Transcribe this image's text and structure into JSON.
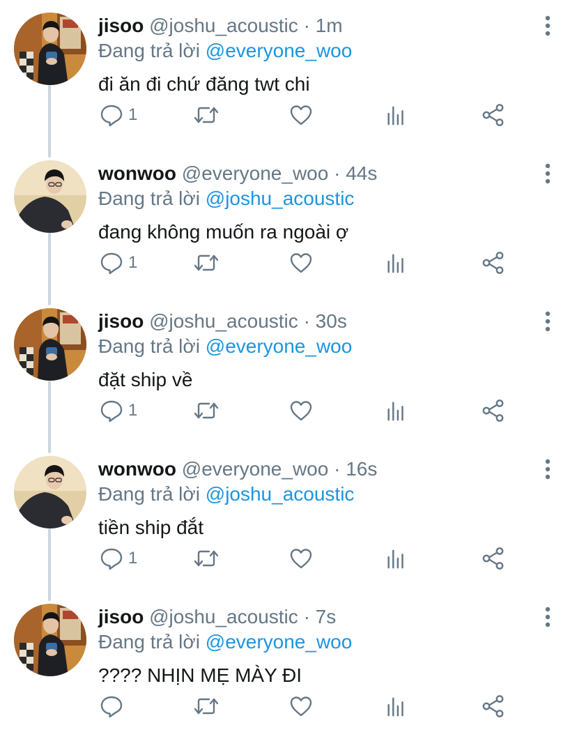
{
  "replying_prefix": "Đang trả lời",
  "colors": {
    "link": "#1b95e0",
    "secondary": "#657786",
    "thread_line": "#ccd6dd"
  },
  "icons": [
    "reply-icon",
    "retweet-icon",
    "like-icon",
    "analytics-icon",
    "share-icon",
    "more-options-icon"
  ],
  "tweets": [
    {
      "name": "jisoo",
      "handle": "@joshu_acoustic",
      "separator": "·",
      "time": "1m",
      "reply_to": "@everyone_woo",
      "text": "đi ăn đi chứ đăng twt chi",
      "reply_count": "1"
    },
    {
      "name": "wonwoo",
      "handle": "@everyone_woo",
      "separator": "·",
      "time": "44s",
      "reply_to": "@joshu_acoustic",
      "text": "đang không muốn ra ngoài ợ",
      "reply_count": "1"
    },
    {
      "name": "jisoo",
      "handle": "@joshu_acoustic",
      "separator": "·",
      "time": "30s",
      "reply_to": "@everyone_woo",
      "text": "đặt ship về",
      "reply_count": "1"
    },
    {
      "name": "wonwoo",
      "handle": "@everyone_woo",
      "separator": "·",
      "time": "16s",
      "reply_to": "@joshu_acoustic",
      "text": "tiền ship đắt",
      "reply_count": "1"
    },
    {
      "name": "jisoo",
      "handle": "@joshu_acoustic",
      "separator": "·",
      "time": "7s",
      "reply_to": "@everyone_woo",
      "text": "???? NHỊN MẸ MÀY ĐI",
      "reply_count": ""
    }
  ]
}
